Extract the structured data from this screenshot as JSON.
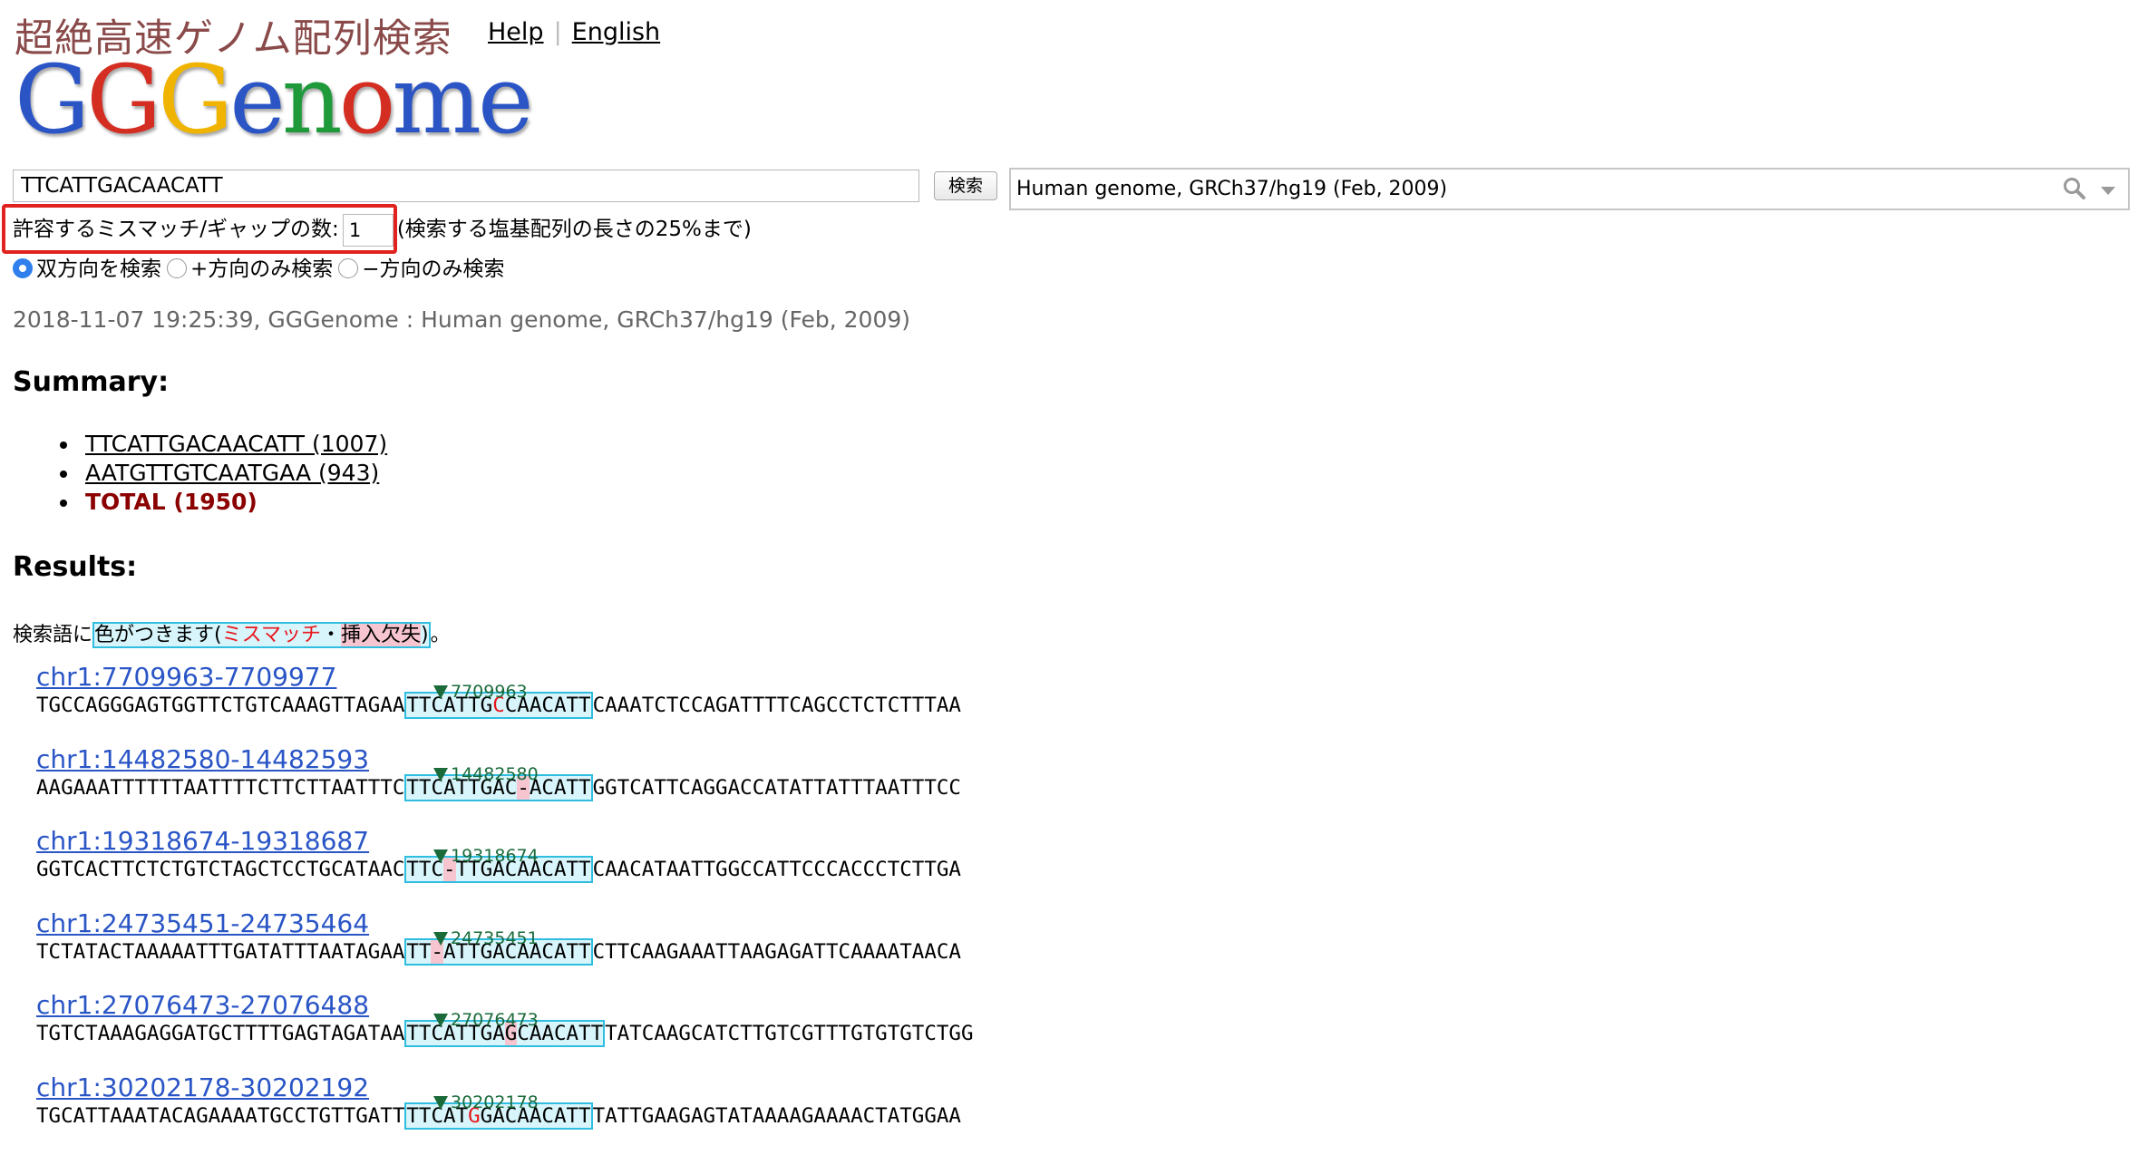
{
  "header": {
    "tagline": "超絶高速ゲノム配列検索",
    "logo_letters": [
      {
        "ch": "G",
        "color": "#2b55c5"
      },
      {
        "ch": "G",
        "color": "#d42d21"
      },
      {
        "ch": "G",
        "color": "#f0b400"
      },
      {
        "ch": "e",
        "color": "#2b55c5"
      },
      {
        "ch": "n",
        "color": "#1e9a3b"
      },
      {
        "ch": "o",
        "color": "#d42d21"
      },
      {
        "ch": "m",
        "color": "#2b55c5"
      },
      {
        "ch": "e",
        "color": "#2b55c5"
      }
    ],
    "help_link": "Help",
    "separator": "|",
    "language_link": "English"
  },
  "search": {
    "query": "TTCATTGACAACATT",
    "button_label": "検索",
    "database": "Human genome, GRCh37/hg19 (Feb, 2009)",
    "mismatch_label": "許容するミスマッチ/ギャップの数:",
    "mismatch_value": "1",
    "mismatch_note": "(検索する塩基配列の長さの25%まで)",
    "strand_options": [
      {
        "label": "双方向を検索",
        "selected": true
      },
      {
        "label": "+方向のみ検索",
        "selected": false
      },
      {
        "label": "−方向のみ検索",
        "selected": false
      }
    ]
  },
  "status_line": "2018-11-07 19:25:39, GGGenome : Human genome, GRCh37/hg19 (Feb, 2009)",
  "summary": {
    "heading": "Summary:",
    "items": [
      {
        "label": "TTCATTGACAACATT (1007)"
      },
      {
        "label": "AATGTTGTCAATGAA (943)"
      }
    ],
    "total": "TOTAL (1950)"
  },
  "results": {
    "heading": "Results:",
    "legend_prefix": "検索語に",
    "legend_box_a": "色がつきます(",
    "legend_mismatch": "ミスマッチ",
    "legend_dot": "・",
    "legend_indel": "挿入欠失",
    "legend_box_b": ")",
    "legend_suffix": "。",
    "hits": [
      {
        "location": "chr1:7709963-7709977",
        "position": "7709963",
        "left": "TGCCAGGGAGTGGTTCTGTCAAAGTTAGAA",
        "hit": [
          {
            "t": "TTCATTG",
            "k": "n"
          },
          {
            "t": "C",
            "k": "mm"
          },
          {
            "t": "CAACATT",
            "k": "n"
          }
        ],
        "right": "CAAATCTCCAGATTTTCAGCCTCTCTTTAA"
      },
      {
        "location": "chr1:14482580-14482593",
        "position": "14482580",
        "left": "AAGAAATTTTTTAATTTTCTTCTTAATTTC",
        "hit": [
          {
            "t": "TTCATTGAC",
            "k": "n"
          },
          {
            "t": "-",
            "k": "gap"
          },
          {
            "t": "ACATT",
            "k": "n"
          }
        ],
        "right": "GGTCATTCAGGACCATATTATTTAATTTCC"
      },
      {
        "location": "chr1:19318674-19318687",
        "position": "19318674",
        "left": "GGTCACTTCTCTGTCTAGCTCCTGCATAAC",
        "hit": [
          {
            "t": "TTC",
            "k": "n"
          },
          {
            "t": "-",
            "k": "gap"
          },
          {
            "t": "TTGACAACATT",
            "k": "n"
          }
        ],
        "right": "CAACATAATTGGCCATTCCCACCCTCTTGA"
      },
      {
        "location": "chr1:24735451-24735464",
        "position": "24735451",
        "left": "TCTATACTAAAAATTTGATATTTAATAGAA",
        "hit": [
          {
            "t": "TT",
            "k": "n"
          },
          {
            "t": "-",
            "k": "gap"
          },
          {
            "t": "ATTGACAACATT",
            "k": "n"
          }
        ],
        "right": "CTTCAAGAAATTAAGAGATTCAAAATAACA"
      },
      {
        "location": "chr1:27076473-27076488",
        "position": "27076473",
        "left": "TGTCTAAAGAGGATGCTTTTGAGTAGATAA",
        "hit": [
          {
            "t": "TTCATTGA",
            "k": "n"
          },
          {
            "t": "G",
            "k": "gapmm"
          },
          {
            "t": "CAACATT",
            "k": "n"
          }
        ],
        "right": "TATCAAGCATCTTGTCGTTTGTGTGTCTGG"
      },
      {
        "location": "chr1:30202178-30202192",
        "position": "30202178",
        "left": "TGCATTAAATACAGAAAATGCCTGTTGATT",
        "hit": [
          {
            "t": "TTCAT",
            "k": "n"
          },
          {
            "t": "G",
            "k": "mm"
          },
          {
            "t": "GACAACATT",
            "k": "n"
          }
        ],
        "right": "TATTGAAGAGTATAAAAGAAAACTATGGAA"
      }
    ]
  }
}
